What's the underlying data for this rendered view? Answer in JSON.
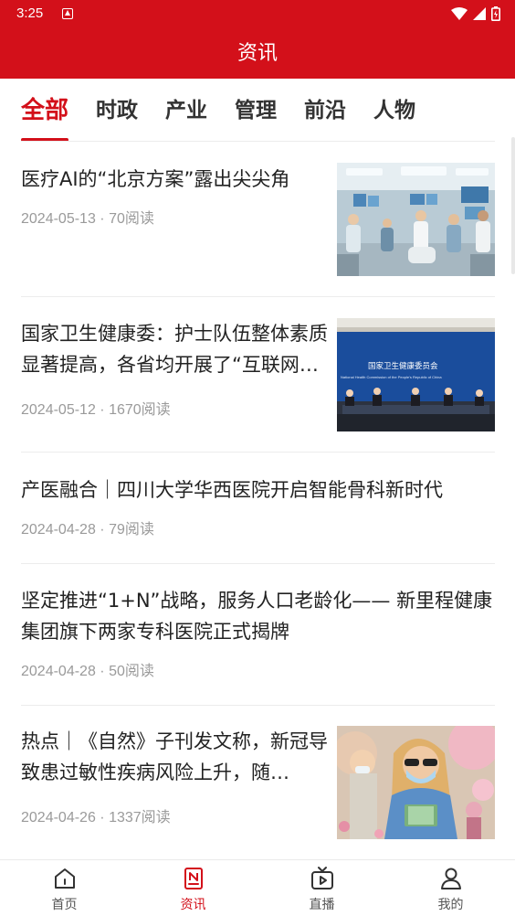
{
  "status_bar": {
    "time": "3:25"
  },
  "header": {
    "title": "资讯"
  },
  "tabs": [
    {
      "label": "全部",
      "active": true
    },
    {
      "label": "时政",
      "active": false
    },
    {
      "label": "产业",
      "active": false
    },
    {
      "label": "管理",
      "active": false
    },
    {
      "label": "前沿",
      "active": false
    },
    {
      "label": "人物",
      "active": false
    }
  ],
  "articles": [
    {
      "title": "医疗AI的“北京方案”露出尖尖角",
      "meta": "2024-05-13 · 70阅读",
      "thumb": "ai-hospital-scene"
    },
    {
      "title": "国家卫生健康委：护士队伍整体素质显著提高，各省均开展了“互联网+护理服务”",
      "meta": "2024-05-12 · 1670阅读",
      "thumb": "press-conference",
      "thumb_text": {
        "banner_cn": "国家卫生健康委员会",
        "banner_en": "National Health Commission of the People's Republic of China"
      }
    },
    {
      "title": "产医融合｜四川大学华西医院开启智能骨科新时代",
      "meta": "2024-04-28 · 79阅读",
      "thumb": null
    },
    {
      "title": "坚定推进“1+N”战略，服务人口老龄化—— 新里程健康集团旗下两家专科医院正式揭牌",
      "meta": "2024-04-28 · 50阅读",
      "thumb": null
    },
    {
      "title": "热点｜《自然》子刊发文称，新冠导致患过敏性疾病风险上升，随…",
      "meta": "2024-04-26 · 1337阅读",
      "thumb": "masked-people-spring"
    }
  ],
  "bottom_nav": [
    {
      "label": "首页",
      "icon": "home-icon",
      "active": false
    },
    {
      "label": "资讯",
      "icon": "news-icon",
      "active": true
    },
    {
      "label": "直播",
      "icon": "live-tv-icon",
      "active": false
    },
    {
      "label": "我的",
      "icon": "profile-icon",
      "active": false
    }
  ],
  "colors": {
    "brand_red": "#d3101a",
    "meta_gray": "#9a9a9a",
    "divider": "#ececec"
  }
}
